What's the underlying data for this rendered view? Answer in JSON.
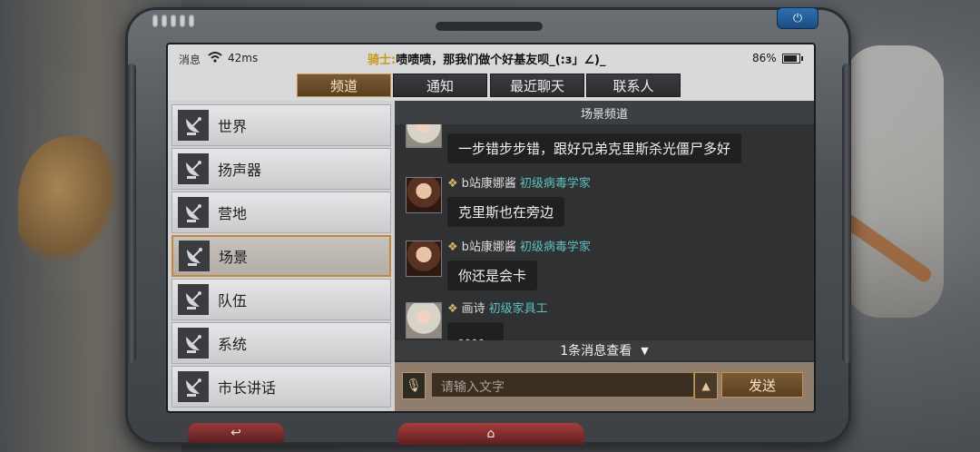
{
  "status_bar": {
    "messages_label": "消息",
    "ping": "42ms",
    "broadcast_sender": "骑士:",
    "broadcast_text": "啧啧啧，那我们做个好基友呗_(:з」∠)_",
    "battery_text": "86%",
    "battery_level": 0.86
  },
  "tabs": [
    {
      "label": "频道",
      "active": true
    },
    {
      "label": "通知",
      "active": false
    },
    {
      "label": "最近聊天",
      "active": false
    },
    {
      "label": "联系人",
      "active": false
    }
  ],
  "channels": [
    {
      "label": "世界",
      "active": false,
      "icon": "satellite-dish-icon"
    },
    {
      "label": "扬声器",
      "active": false,
      "icon": "satellite-dish-icon"
    },
    {
      "label": "营地",
      "active": false,
      "icon": "satellite-dish-icon"
    },
    {
      "label": "场景",
      "active": true,
      "icon": "satellite-dish-icon"
    },
    {
      "label": "队伍",
      "active": false,
      "icon": "satellite-dish-icon"
    },
    {
      "label": "系统",
      "active": false,
      "icon": "satellite-dish-icon"
    },
    {
      "label": "市长讲话",
      "active": false,
      "icon": "satellite-dish-icon"
    }
  ],
  "chat": {
    "header": "场景频道",
    "messages": [
      {
        "name": "",
        "title": "",
        "text": "一步错步步错，跟好兄弟克里斯杀光僵尸多好",
        "avatar": "blonde"
      },
      {
        "name": "b站康娜酱",
        "title": "初级病毒学家",
        "text": "克里斯也在旁边",
        "avatar": "brown"
      },
      {
        "name": "b站康娜酱",
        "title": "初级病毒学家",
        "text": "你还是会卡",
        "avatar": "brown"
      },
      {
        "name": "画诗",
        "title": "初级家具工",
        "text": "。。。。",
        "avatar": "blonde"
      }
    ],
    "more_label": "1条消息查看",
    "input_placeholder": "请输入文字",
    "send_label": "发送"
  },
  "colors": {
    "accent": "#c79353",
    "title_cyan": "#5fc0c0",
    "marquee_sender": "#c79a1a"
  }
}
